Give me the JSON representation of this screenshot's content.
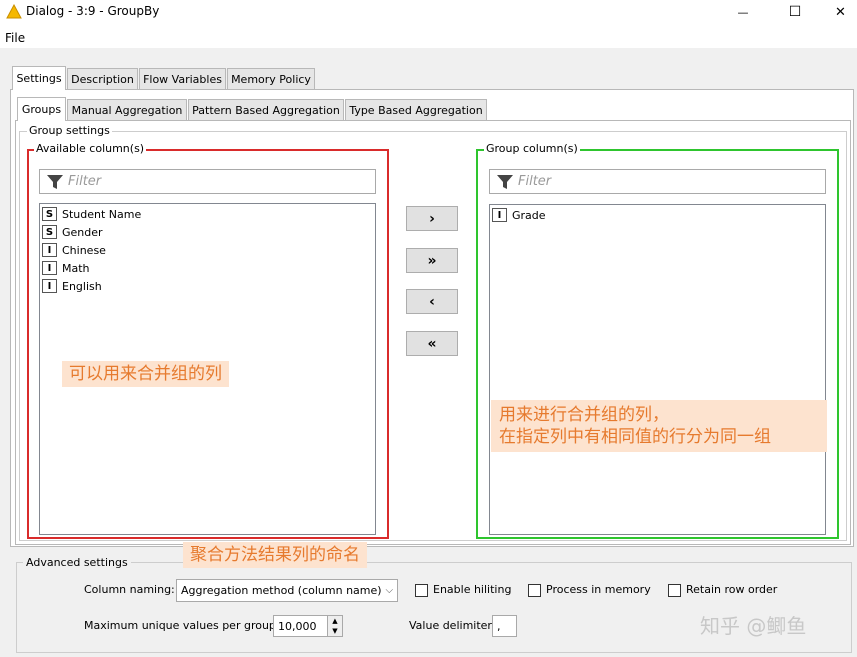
{
  "window": {
    "title": "Dialog - 3:9 - GroupBy",
    "minimize_glyph": "—",
    "maximize_glyph": "☐",
    "close_glyph": "✕"
  },
  "menu": {
    "file": "File"
  },
  "tabs": [
    {
      "label": "Settings",
      "active": true
    },
    {
      "label": "Description",
      "active": false
    },
    {
      "label": "Flow Variables",
      "active": false
    },
    {
      "label": "Memory Policy",
      "active": false
    }
  ],
  "subtabs": [
    {
      "label": "Groups",
      "active": true
    },
    {
      "label": "Manual Aggregation",
      "active": false
    },
    {
      "label": "Pattern Based Aggregation",
      "active": false
    },
    {
      "label": "Type Based Aggregation",
      "active": false
    }
  ],
  "group_settings": {
    "title": "Group settings",
    "available": {
      "title": "Available column(s)",
      "filter_placeholder": "Filter",
      "columns": [
        {
          "type": "S",
          "name": "Student Name"
        },
        {
          "type": "S",
          "name": "Gender"
        },
        {
          "type": "I",
          "name": "Chinese"
        },
        {
          "type": "I",
          "name": "Math"
        },
        {
          "type": "I",
          "name": "English"
        }
      ],
      "border_color": "#d92b2b"
    },
    "group": {
      "title": "Group column(s)",
      "filter_placeholder": "Filter",
      "columns": [
        {
          "type": "I",
          "name": "Grade"
        }
      ],
      "border_color": "#2ec52e"
    },
    "buttons": {
      "add": "›",
      "add_all": "»",
      "remove": "‹",
      "remove_all": "«"
    }
  },
  "annotations": {
    "available_note": "可以用来合并组的列",
    "group_note_line1": "用来进行合并组的列，",
    "group_note_line2": "在指定列中有相同值的行分为同一组",
    "naming_note": "聚合方法结果列的命名",
    "color": "#e67a2e",
    "background": "#fde3cf"
  },
  "advanced": {
    "title": "Advanced settings",
    "column_naming_label": "Column naming:",
    "column_naming_value": "Aggregation method (column name)",
    "enable_hiliting": "Enable hiliting",
    "process_in_memory": "Process in memory",
    "retain_row_order": "Retain row order",
    "max_unique_label": "Maximum unique values per group",
    "max_unique_value": "10,000",
    "value_delimiter_label": "Value delimiter",
    "value_delimiter_value": ","
  },
  "watermark": "知乎 @鲫鱼",
  "icons": {
    "title_icon": "warning-triangle-icon",
    "filter_icon": "funnel-icon"
  }
}
